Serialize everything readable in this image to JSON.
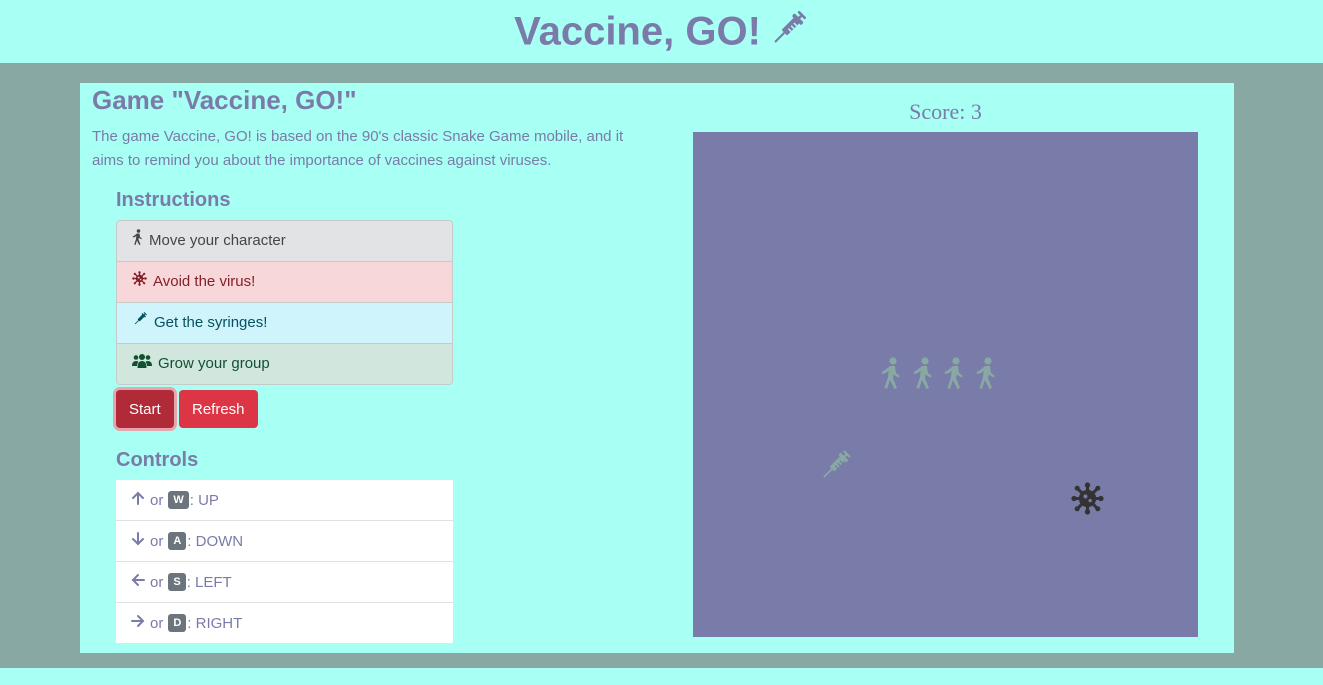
{
  "header": {
    "title": "Vaccine, GO!",
    "icon": "syringe-icon"
  },
  "main": {
    "title": "Game \"Vaccine, GO!\"",
    "description": "The game Vaccine, GO! is based on the 90's classic Snake Game mobile, and it aims to remind you about the importance of vaccines against viruses."
  },
  "instructions": {
    "heading": "Instructions",
    "items": [
      {
        "icon": "walking-person-icon",
        "label": "Move your character"
      },
      {
        "icon": "virus-icon",
        "label": "Avoid the virus!"
      },
      {
        "icon": "syringe-icon",
        "label": "Get the syringes!"
      },
      {
        "icon": "group-icon",
        "label": "Grow your group"
      }
    ]
  },
  "buttons": {
    "start": "Start",
    "refresh": "Refresh"
  },
  "controls": {
    "heading": "Controls",
    "or_text": "or",
    "items": [
      {
        "arrow": "arrow-up-icon",
        "key": "W",
        "action": ": UP"
      },
      {
        "arrow": "arrow-down-icon",
        "key": "A",
        "action": ": DOWN"
      },
      {
        "arrow": "arrow-left-icon",
        "key": "S",
        "action": ": LEFT"
      },
      {
        "arrow": "arrow-right-icon",
        "key": "D",
        "action": ": RIGHT"
      }
    ]
  },
  "game": {
    "score_label": "Score: 3",
    "board_color": "#797ba9",
    "sprite_color": "#87a8a3",
    "virus_color": "#333333"
  },
  "colors": {
    "background": "#a8fff4",
    "band": "#87a8a3",
    "text": "#7a7ba8",
    "danger": "#dc3545"
  }
}
